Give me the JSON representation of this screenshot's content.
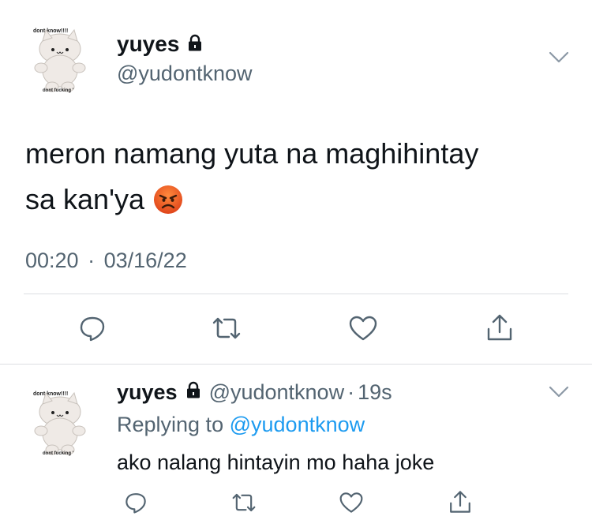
{
  "main_tweet": {
    "display_name": "yuyes",
    "handle": "@yudontknow",
    "text_line1": "meron namang yuta na maghihintay",
    "text_line2": "sa kan'ya",
    "emoji": "angry-face-emoji",
    "time": "00:20",
    "separator": "·",
    "date": "03/16/22",
    "avatar_caption_top": "dont know!!!!",
    "avatar_caption_bottom": "dont fucking '"
  },
  "reply": {
    "display_name": "yuyes",
    "handle": "@yudontknow",
    "separator": "·",
    "age": "19s",
    "replying_prefix": "Replying to",
    "replying_to": "@yudontknow",
    "text": "ako nalang hintayin mo haha joke",
    "avatar_caption_top": "dont know!!!!",
    "avatar_caption_bottom": "dont fucking '"
  },
  "icons": [
    "lock-icon",
    "chevron-down-icon",
    "reply-icon",
    "retweet-icon",
    "like-icon",
    "share-icon"
  ],
  "colors": {
    "text": "#0f1419",
    "muted": "#536471",
    "link": "#1d9bf0",
    "icon": "#536471",
    "divider": "#dcdfe3",
    "emoji": "#e85a1d"
  }
}
